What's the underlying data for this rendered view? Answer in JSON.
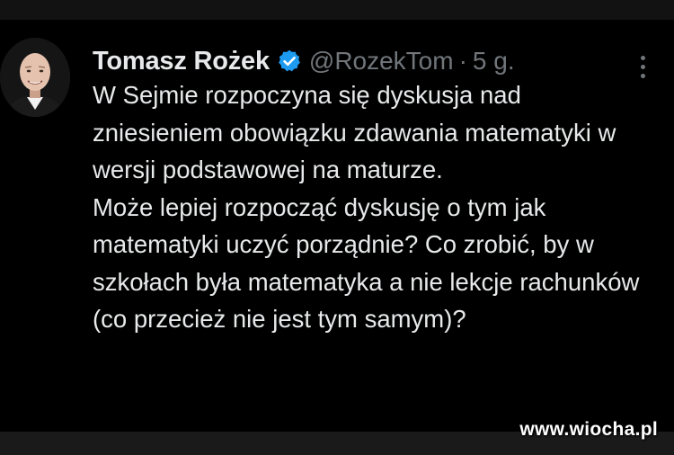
{
  "tweet": {
    "author_name": "Tomasz Rożek",
    "handle": "@RozekTom",
    "separator": "·",
    "time_ago": "5 g.",
    "verified_icon": "verified-badge-icon",
    "more_icon": "more-vertical-icon",
    "text_paragraphs": [
      "W Sejmie rozpoczyna się dyskusja nad zniesieniem obowiązku zdawania matematyki w wersji podstawowej na maturze.",
      "Może lepiej rozpocząć dyskusję o tym jak matematyki uczyć porządnie? Co zrobić, by w szkołach była matematyka a nie lekcje rachunków (co przecież nie jest tym samym)?"
    ]
  },
  "watermark": {
    "text": "www.wiocha.pl"
  },
  "colors": {
    "background": "#000000",
    "text_primary": "#e7e9ea",
    "text_secondary": "#71767b",
    "verified_blue": "#1d9bf0"
  }
}
